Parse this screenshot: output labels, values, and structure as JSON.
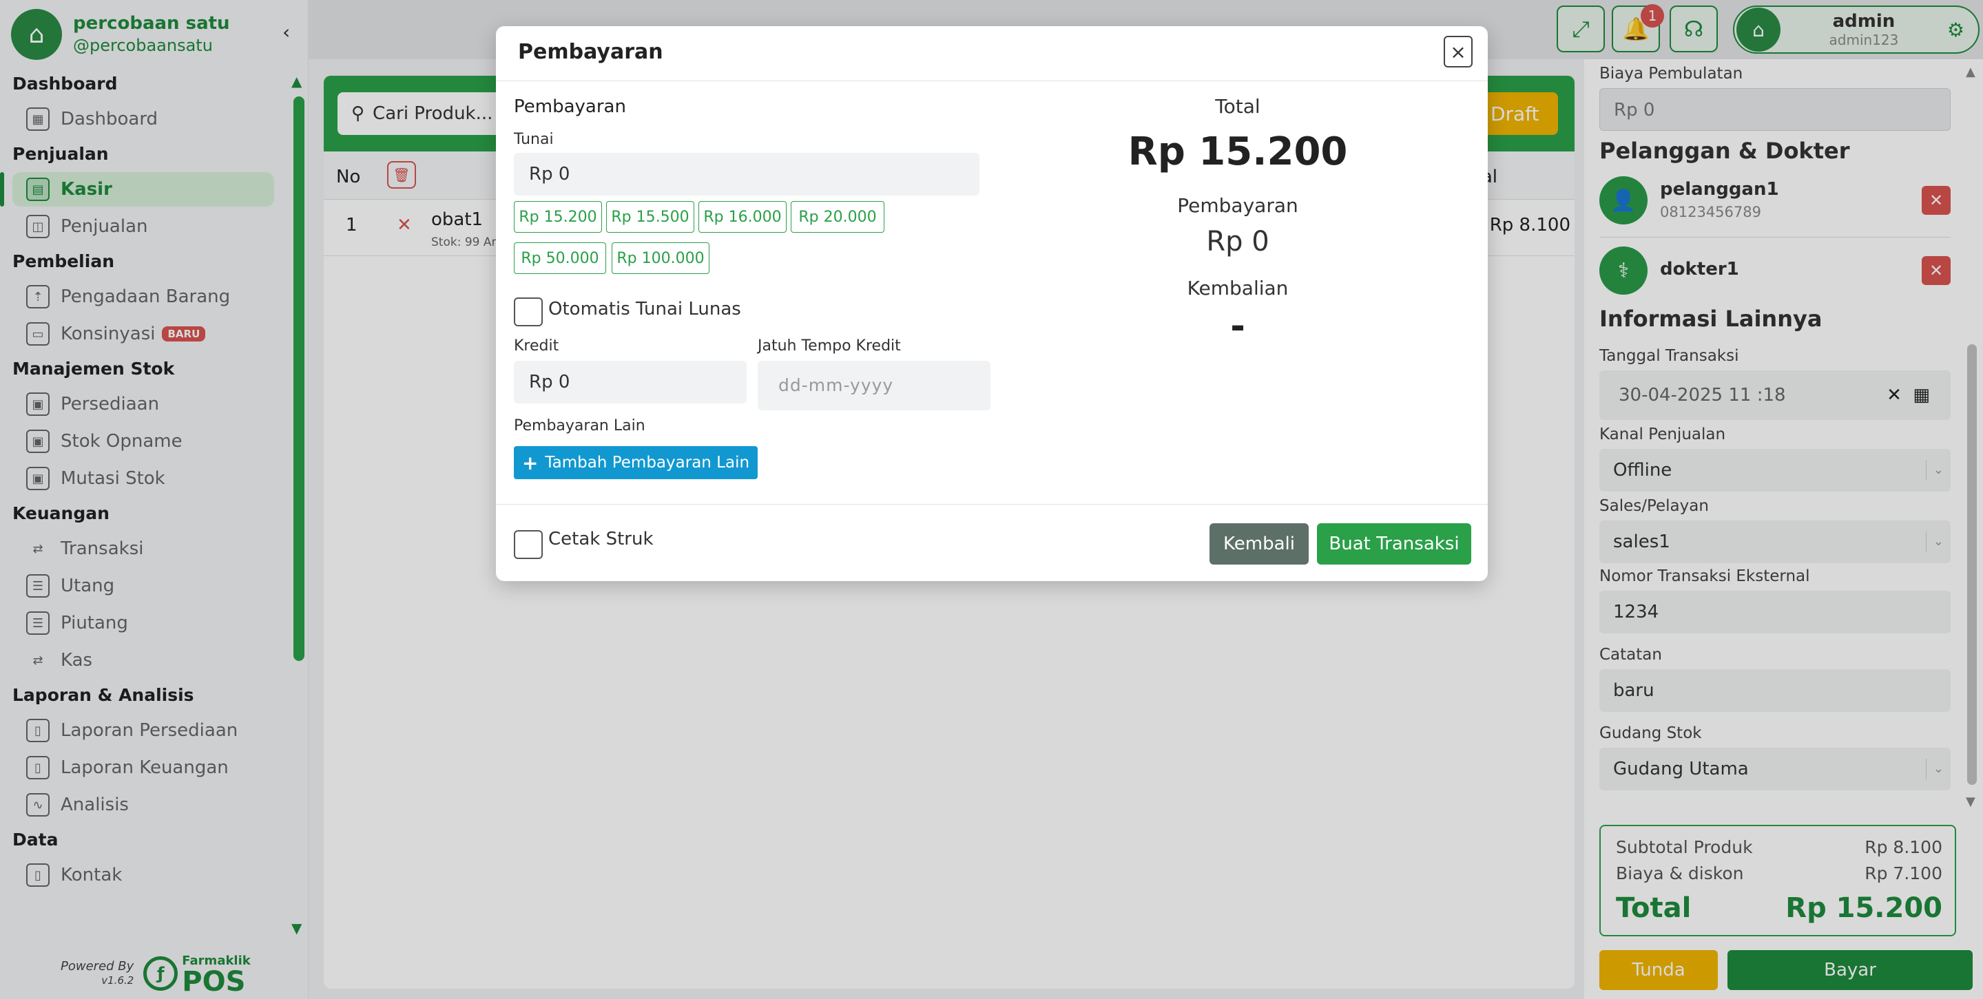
{
  "brand": {
    "name": "percobaan satu",
    "handle": "@percobaansatu"
  },
  "sidebar": {
    "sections": [
      {
        "title": "Dashboard",
        "items": [
          {
            "label": "Dashboard"
          }
        ]
      },
      {
        "title": "Penjualan",
        "items": [
          {
            "label": "Kasir",
            "active": true
          },
          {
            "label": "Penjualan"
          }
        ]
      },
      {
        "title": "Pembelian",
        "items": [
          {
            "label": "Pengadaan Barang"
          },
          {
            "label": "Konsinyasi",
            "badge": "BARU"
          }
        ]
      },
      {
        "title": "Manajemen Stok",
        "items": [
          {
            "label": "Persediaan"
          },
          {
            "label": "Stok Opname"
          },
          {
            "label": "Mutasi Stok"
          }
        ]
      },
      {
        "title": "Keuangan",
        "items": [
          {
            "label": "Transaksi"
          },
          {
            "label": "Utang"
          },
          {
            "label": "Piutang"
          },
          {
            "label": "Kas"
          }
        ]
      },
      {
        "title": "Laporan & Analisis",
        "items": [
          {
            "label": "Laporan Persediaan"
          },
          {
            "label": "Laporan Keuangan"
          },
          {
            "label": "Analisis"
          }
        ]
      },
      {
        "title": "Data",
        "items": [
          {
            "label": "Kontak"
          }
        ]
      }
    ],
    "powered_by": "Powered By",
    "version": "v1.6.2",
    "logo_small": "Farmaklik",
    "logo_big": "POS"
  },
  "topbar": {
    "notification_count": "1",
    "user_name": "admin",
    "user_handle": "admin123"
  },
  "main": {
    "search_placeholder": "Cari Produk...",
    "draft_label": "Draft",
    "col_no": "No",
    "col_total": "al",
    "rows": [
      {
        "no": "1",
        "name": "obat1",
        "stok": "Stok: 99 An",
        "price": "Rp 8.100"
      }
    ]
  },
  "right_panel": {
    "biaya_pembulatan_label": "Biaya Pembulatan",
    "biaya_pembulatan_value": "Rp 0",
    "pelanggan_heading": "Pelanggan & Dokter",
    "customer_name": "pelanggan1",
    "customer_phone": "08123456789",
    "doctor_name": "dokter1",
    "info_heading": "Informasi Lainnya",
    "tanggal_label": "Tanggal Transaksi",
    "tanggal_value": "30-04-2025 11 :18",
    "kanal_label": "Kanal Penjualan",
    "kanal_value": "Offline",
    "sales_label": "Sales/Pelayan",
    "sales_value": "sales1",
    "nomor_label": "Nomor Transaksi Eksternal",
    "nomor_value": "1234",
    "catatan_label": "Catatan",
    "catatan_value": "baru",
    "gudang_label": "Gudang Stok",
    "gudang_value": "Gudang Utama",
    "subtotal_label": "Subtotal Produk",
    "subtotal_value": "Rp 8.100",
    "biaya_label": "Biaya & diskon",
    "biaya_value": "Rp 7.100",
    "total_label": "Total",
    "total_value": "Rp 15.200",
    "tunda_label": "Tunda",
    "bayar_label": "Bayar"
  },
  "modal": {
    "title": "Pembayaran",
    "section": "Pembayaran",
    "tunai_label": "Tunai",
    "tunai_value": "Rp 0",
    "quick_amounts": [
      "Rp 15.200",
      "Rp 15.500",
      "Rp 16.000",
      "Rp 20.000",
      "Rp 50.000",
      "Rp 100.000"
    ],
    "otomatis_label": "Otomatis Tunai Lunas",
    "kredit_label": "Kredit",
    "kredit_value": "Rp 0",
    "jatuh_tempo_label": "Jatuh Tempo Kredit",
    "jatuh_tempo_placeholder": "dd-mm-yyyy",
    "lain_label": "Pembayaran Lain",
    "tambah_label": "Tambah Pembayaran Lain",
    "cetak_label": "Cetak Struk",
    "kembali_label": "Kembali",
    "buat_label": "Buat Transaksi",
    "summary_total_label": "Total",
    "summary_total_value": "Rp 15.200",
    "summary_pembayaran_label": "Pembayaran",
    "summary_pembayaran_value": "Rp 0",
    "summary_kembalian_label": "Kembalian",
    "summary_kembalian_value": "-"
  },
  "colors": {
    "primary": "#2aa048",
    "dark_green": "#1e8a3c",
    "danger": "#d9534f",
    "warning": "#f0b400",
    "info": "#1198d1"
  }
}
